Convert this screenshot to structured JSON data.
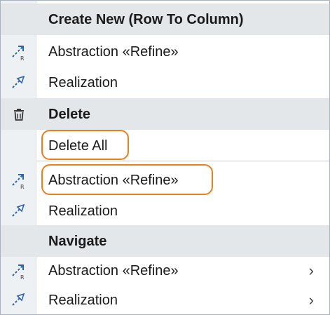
{
  "menu": {
    "sections": [
      {
        "header": "Create New (Row To Column)",
        "items": [
          {
            "label": "Abstraction «Refine»",
            "icon": "abstraction-refine-icon"
          },
          {
            "label": "Realization",
            "icon": "realization-icon"
          }
        ]
      },
      {
        "header": "Delete",
        "header_icon": "trash-icon",
        "items": [
          {
            "label": "Delete All",
            "highlighted": true
          },
          {
            "label": "Abstraction «Refine»",
            "icon": "abstraction-refine-icon",
            "highlighted": true
          },
          {
            "label": "Realization",
            "icon": "realization-icon"
          }
        ]
      },
      {
        "header": "Navigate",
        "items": [
          {
            "label": "Abstraction «Refine»",
            "icon": "abstraction-refine-icon",
            "submenu": true
          },
          {
            "label": "Realization",
            "icon": "realization-icon",
            "submenu": true
          }
        ]
      }
    ],
    "submenu_glyph": "›",
    "colors": {
      "highlight": "#ef7d1a",
      "icon": "#2a63b4",
      "header_bg": "#e4e7ea",
      "gutter_bg": "#eef1f4"
    }
  }
}
